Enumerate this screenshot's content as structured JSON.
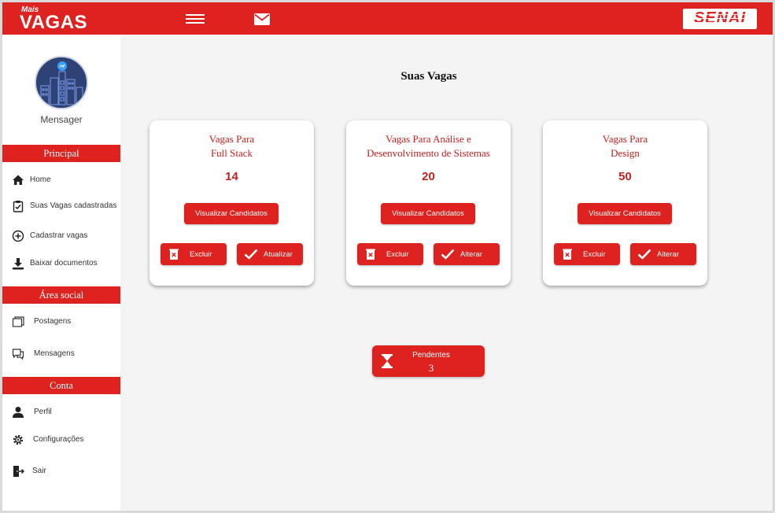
{
  "header": {
    "logo_small": "Mais",
    "logo_big": "VAGAS",
    "brand_right": "SENAI"
  },
  "sidebar": {
    "user_name": "Mensager",
    "sections": {
      "principal": "Principal",
      "social": "Área social",
      "conta": "Conta"
    },
    "items": [
      {
        "label": "Home",
        "icon": "home-icon"
      },
      {
        "label": "Suas Vagas cadastradas",
        "icon": "clipboard-check-icon"
      },
      {
        "label": "Cadastrar vagas",
        "icon": "plus-circle-icon"
      },
      {
        "label": "Baixar documentos",
        "icon": "download-icon"
      },
      {
        "label": "Postagens",
        "icon": "posts-icon"
      },
      {
        "label": "Mensagens",
        "icon": "chat-icon"
      },
      {
        "label": "Perfil",
        "icon": "user-icon"
      },
      {
        "label": "Configurações",
        "icon": "gear-icon"
      },
      {
        "label": "Sair",
        "icon": "logout-icon"
      }
    ]
  },
  "main": {
    "title": "Suas Vagas",
    "cards": [
      {
        "title_line1": "Vagas Para",
        "title_line2": "Full Stack",
        "count": "14",
        "view_label": "Visualizar Candidatos",
        "delete_label": "Excluir",
        "edit_label": "Atualizar"
      },
      {
        "title_line1": "Vagas Para Análise e",
        "title_line2": "Desenvolvimento de Sistemas",
        "count": "20",
        "view_label": "Visualizar Candidatos",
        "delete_label": "Excluir",
        "edit_label": "Alterar"
      },
      {
        "title_line1": "Vagas Para",
        "title_line2": "Design",
        "count": "50",
        "view_label": "Visualizar Candidatos",
        "delete_label": "Excluir",
        "edit_label": "Alterar"
      }
    ],
    "pending": {
      "label": "Pendentes",
      "count": "3"
    }
  },
  "colors": {
    "brand_red": "#dd2220",
    "text_red": "#c2211f",
    "avatar_bg": "#2f4275"
  }
}
